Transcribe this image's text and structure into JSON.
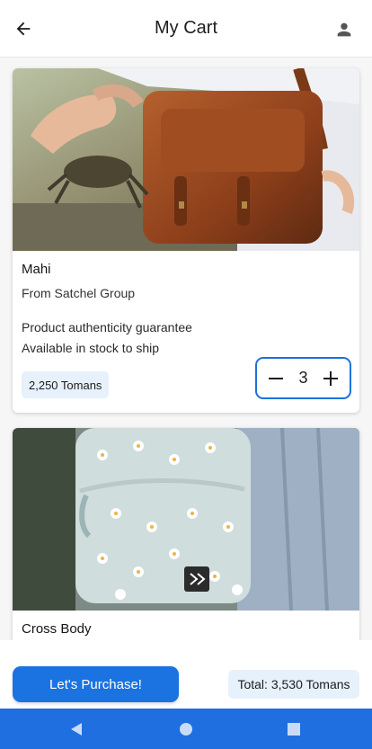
{
  "header": {
    "title": "My Cart",
    "back_icon": "arrow-left-icon",
    "profile_icon": "person-icon"
  },
  "cart": {
    "items": [
      {
        "name": "Mahi",
        "seller": "From Satchel Group",
        "features": [
          "Product authenticity guarantee",
          "Available in stock to ship"
        ],
        "price": "2,250 Tomans",
        "quantity": "3"
      },
      {
        "name": "Cross Body"
      }
    ]
  },
  "footer": {
    "purchase_label": "Let's Purchase!",
    "total_label": "Total: 3,530 Tomans"
  },
  "colors": {
    "accent": "#1a73e0",
    "chip_bg": "#e7f1fb",
    "nav_bar": "#1f6fe0"
  },
  "system_nav": {
    "back_icon": "triangle-back-icon",
    "home_icon": "circle-home-icon",
    "recents_icon": "square-recents-icon"
  }
}
